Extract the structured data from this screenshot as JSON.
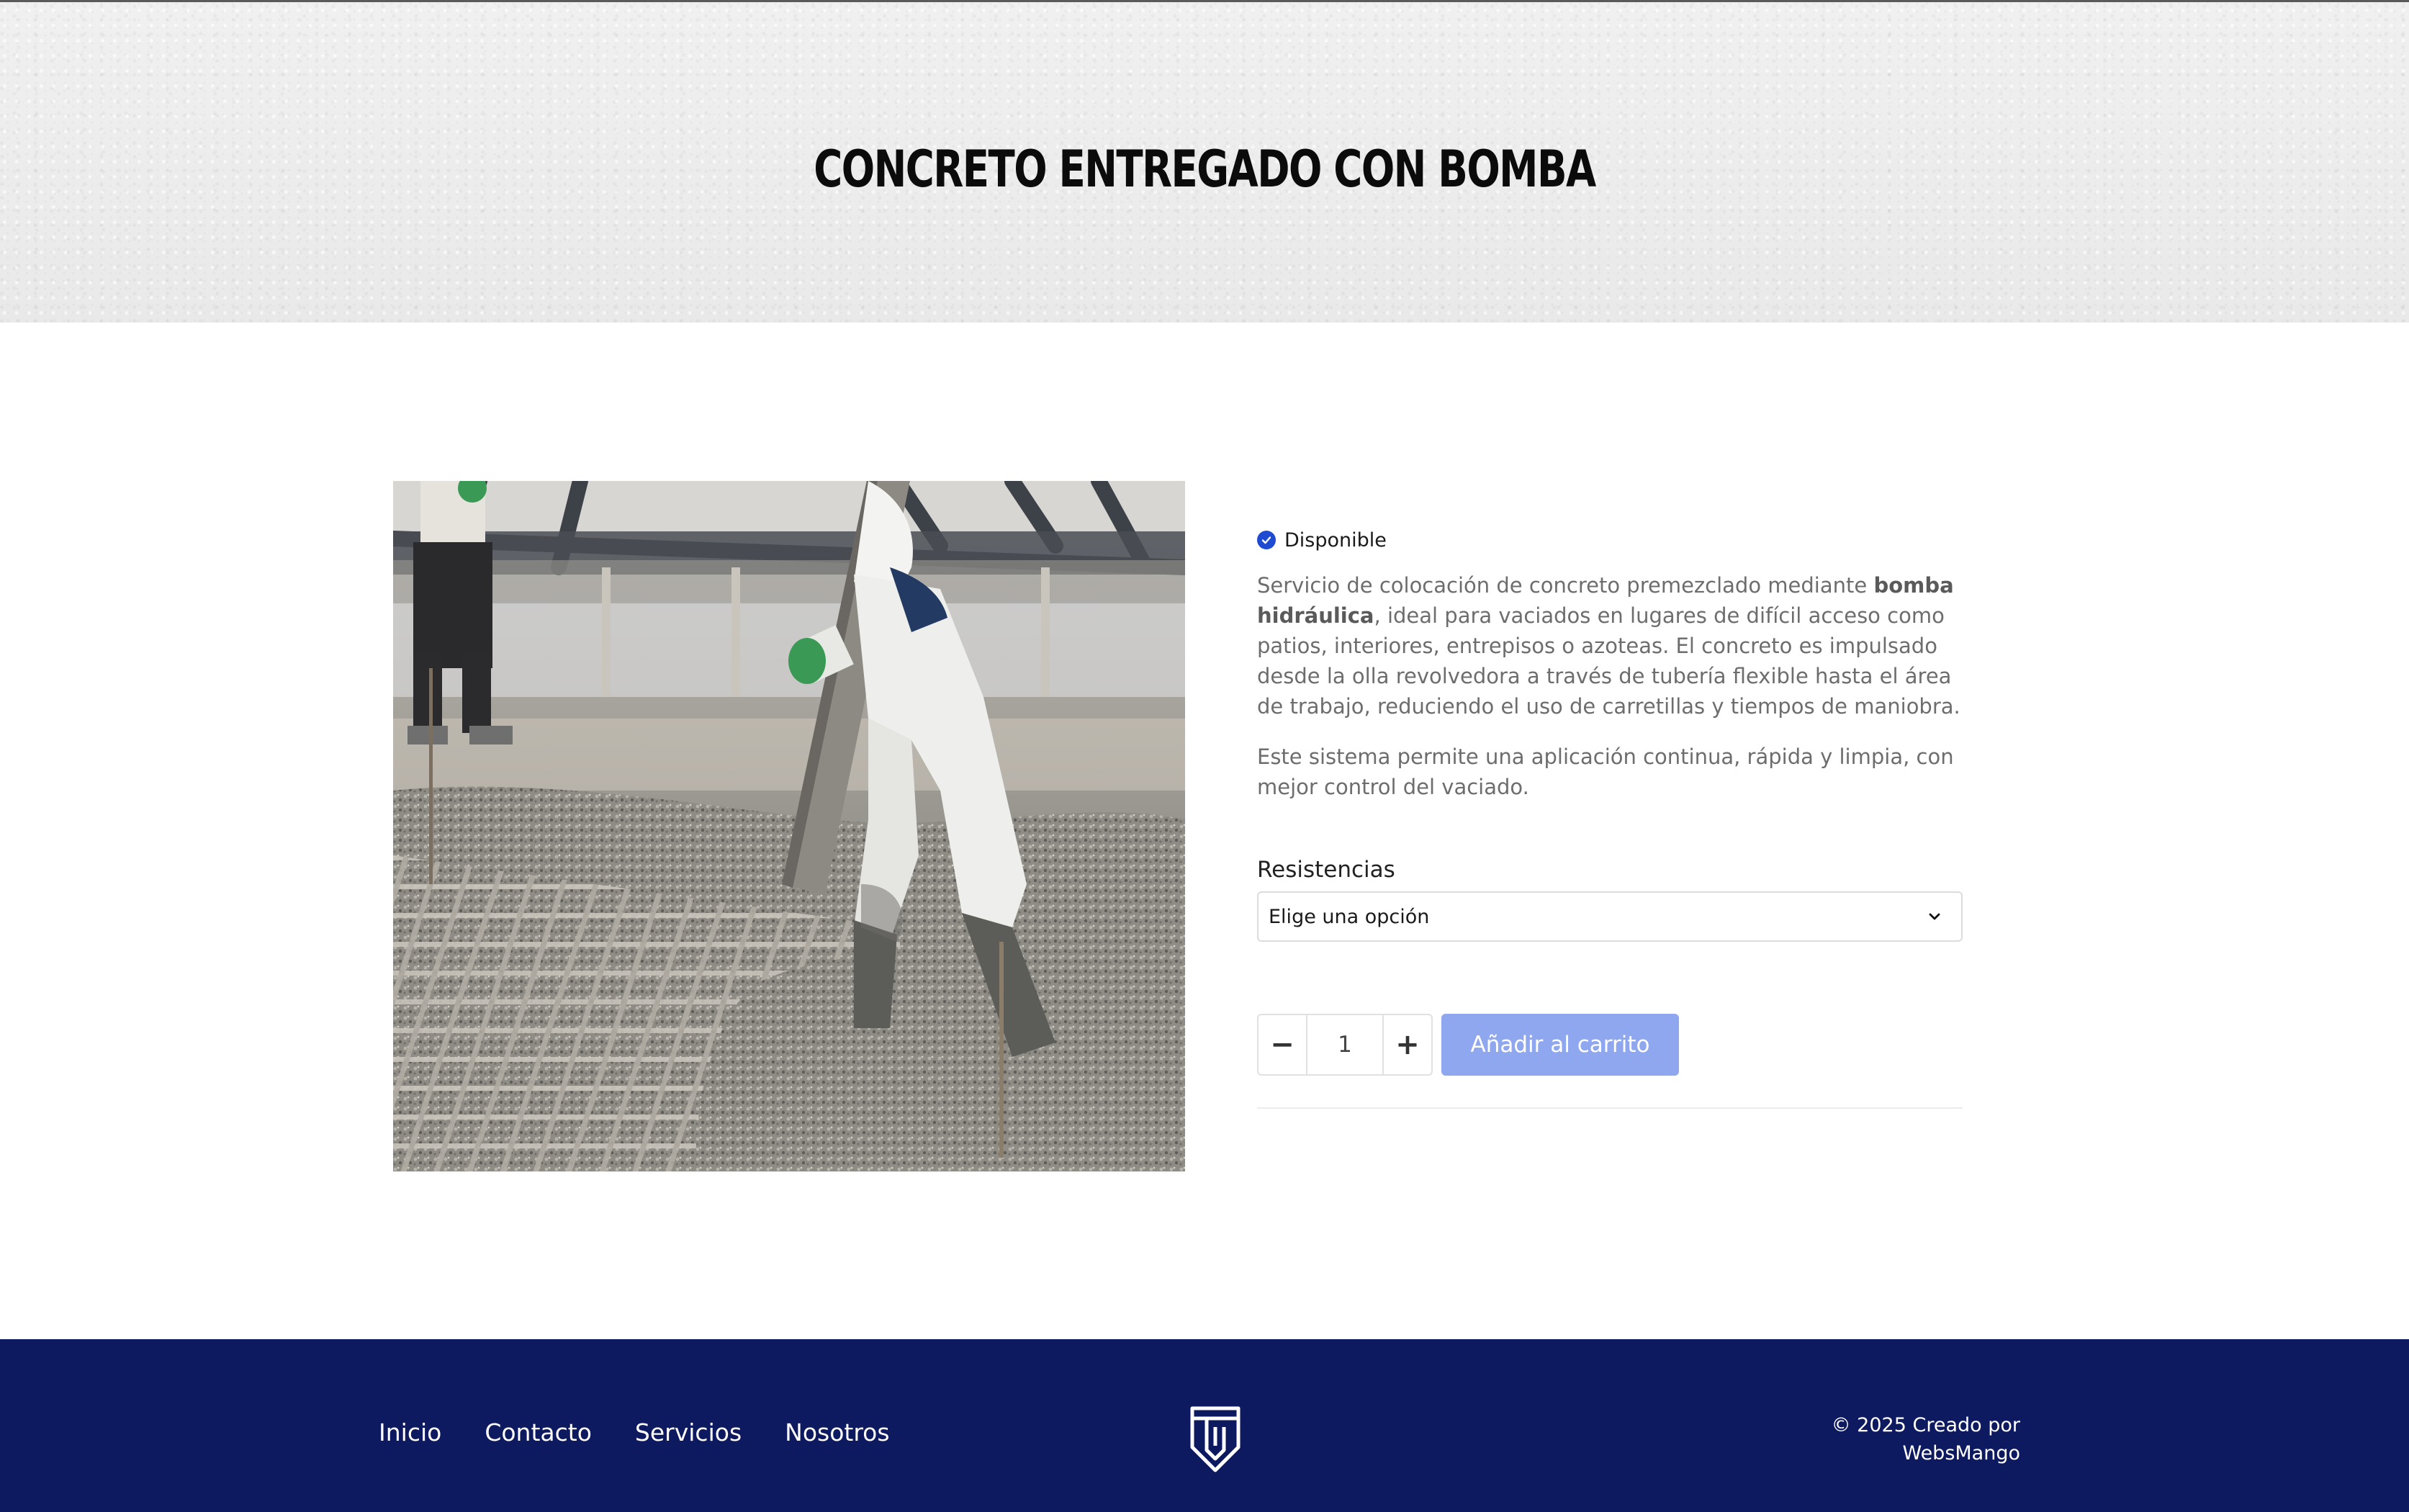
{
  "hero": {
    "title": "CONCRETO ENTREGADO CON BOMBA"
  },
  "product": {
    "image_alt": "Trabajador vaciando concreto con manguera de bomba",
    "stock_status": "Disponible",
    "description": {
      "p1_before": "Servicio de colocación de concreto premezclado mediante ",
      "p1_bold": "bomba hidráulica",
      "p1_after": ", ideal para vaciados en lugares de difícil acceso como patios, interiores, entrepisos o azoteas. El concreto es impulsado desde la olla revolvedora a través de tubería flexible hasta el área de trabajo, reduciendo el uso de carretillas y tiempos de maniobra.",
      "p2": "Este sistema permite una aplicación continua, rápida y limpia, con mejor control del vaciado."
    },
    "variation": {
      "label": "Resistencias",
      "selected": "Elige una opción"
    },
    "quantity": {
      "value": "1",
      "minus": "−",
      "plus": "+"
    },
    "add_to_cart": "Añadir al carrito"
  },
  "footer": {
    "nav": [
      {
        "label": "Inicio"
      },
      {
        "label": "Contacto"
      },
      {
        "label": "Servicios"
      },
      {
        "label": "Nosotros"
      }
    ],
    "copyright_line1": "© 2025 Creado por",
    "copyright_line2": "WebsMango"
  },
  "colors": {
    "accent": "#1e4bd2",
    "button_disabled": "#8ea7ef",
    "footer_bg": "#0e1a5f",
    "text_muted": "#6d6d6d"
  },
  "icons": {
    "stock": "check-circle-icon",
    "select": "chevron-down-icon",
    "logo": "shield-logo-icon"
  }
}
